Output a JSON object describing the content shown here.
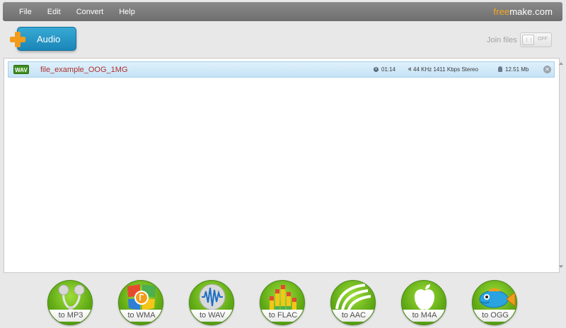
{
  "menubar": {
    "items": [
      "File",
      "Edit",
      "Convert",
      "Help"
    ],
    "brand_free": "free",
    "brand_make": "make.com"
  },
  "toolbar": {
    "audio_label": "Audio",
    "join_label": "Join files",
    "join_state": "OFF"
  },
  "files": [
    {
      "badge": "WAV",
      "name": "file_example_OOG_1MG",
      "duration": "01:14",
      "audio_info": "44 KHz  1411 Kbps  Stereo",
      "size": "12.51 Mb"
    }
  ],
  "formats": [
    {
      "label": "to MP3",
      "icon": "earphones-icon"
    },
    {
      "label": "to WMA",
      "icon": "windows-media-icon"
    },
    {
      "label": "to WAV",
      "icon": "waveform-icon"
    },
    {
      "label": "to FLAC",
      "icon": "equalizer-icon"
    },
    {
      "label": "to AAC",
      "icon": "aac-logo-icon"
    },
    {
      "label": "to M4A",
      "icon": "apple-icon"
    },
    {
      "label": "to OGG",
      "icon": "fish-icon"
    }
  ],
  "colors": {
    "accent_blue": "#1a86b8",
    "brand_orange": "#f5a623",
    "format_green": "#5ea814",
    "file_name_red": "#b0302b"
  }
}
